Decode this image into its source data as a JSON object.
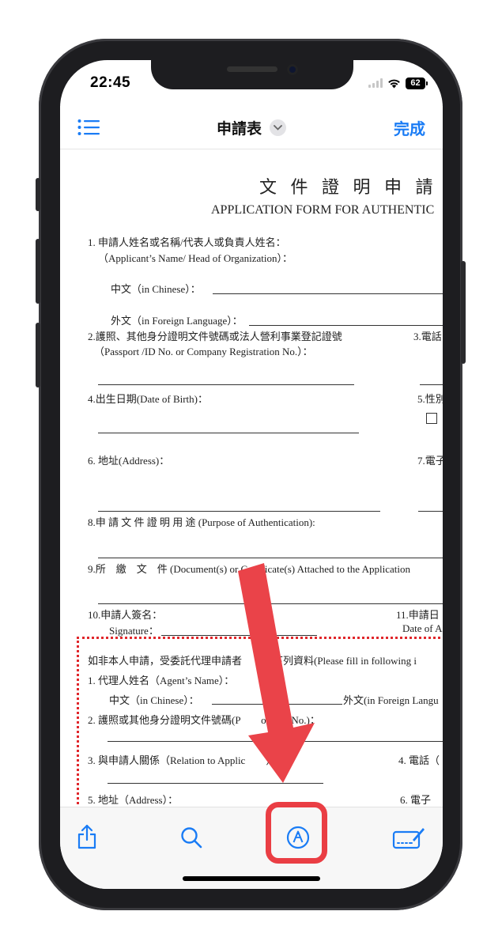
{
  "status_bar": {
    "time": "22:45",
    "battery": "62"
  },
  "nav": {
    "title": "申請表",
    "done_label": "完成"
  },
  "doc": {
    "title_zh": "文 件 證 明 申 請 書",
    "title_en": "APPLICATION FORM FOR AUTHENTIC",
    "f1_label": "1.   申請人姓名或名稱/代表人或負責人姓名：",
    "f1_sub": "（Applicant’s Name/ Head of Organization）：",
    "f1_chinese": "中文（in Chinese）：",
    "f1_foreign": "外文（in Foreign Language）：",
    "f2_label": "2.護照、其他身分證明文件號碼或法人營利事業登記證號",
    "f2_sub": "（Passport /ID No.  or Company Registration No.）：",
    "f3_label": "3.電話",
    "f4_label": "4.出生日期(Date of Birth)：",
    "f5_label": "5.性別",
    "f6_label": "6.  地址(Address)：",
    "f7_label": "7.電子",
    "f8_label": "8.申 請 文 件 證 明 用 途 (Purpose of Authentication):",
    "f9_label": "9.所　繳　文　件 (Document(s) or Certificate(s) Attached to the Application",
    "f10_label": "10.申請人簽名：",
    "f10_sub": "Signature：",
    "f11_label": "11.申請日",
    "f11_sub": "Date of A",
    "agent_intro": "如非本人申請，受委託代理申請者　　寫下列資料(Please fill in following i",
    "a1_label": "1. 代理人姓名（Agent’s Name）：",
    "a1_chinese": "中文（in Chinese）：",
    "a1_foreign": "外文(in Foreign Langu",
    "a2_label": "2.  護照或其他身分證明文件號碼(P　　ort /ID No.)：",
    "a3_label": "3.  與申請人關係（Relation to Applic　　）：",
    "a4_label": "4. 電話（",
    "a5_label": "5.  地址（Address）：",
    "a6_label": "6.  電子"
  },
  "toolbar": {
    "icons": [
      "share-icon",
      "search-icon",
      "markup-icon",
      "signature-icon"
    ]
  },
  "colors": {
    "accent": "#1a7cf5",
    "highlight": "#ea3e44",
    "annotation_dots": "#e0262b"
  }
}
